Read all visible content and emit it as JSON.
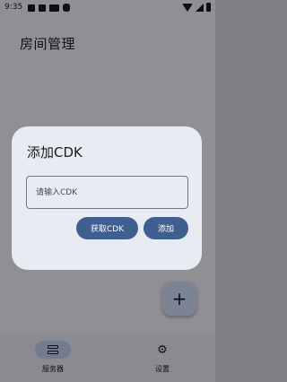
{
  "status_bar": {
    "time": "9:35",
    "left_icons": [
      "notification-icon",
      "media-icon",
      "sim-icon",
      "bug-icon"
    ],
    "right_icons": [
      "wifi-icon",
      "signal-icon",
      "battery-icon"
    ]
  },
  "page": {
    "title": "房间管理"
  },
  "fab": {
    "icon": "plus-icon",
    "label": "+"
  },
  "bottom_nav": {
    "items": [
      {
        "label": "服务器",
        "icon": "server-icon",
        "selected": true
      },
      {
        "label": "设置",
        "icon": "gear-icon",
        "selected": false
      }
    ]
  },
  "dialog": {
    "title": "添加CDK",
    "input": {
      "value": "",
      "placeholder": "请输入CDK"
    },
    "buttons": {
      "get_cdk": "获取CDK",
      "add": "添加"
    }
  },
  "colors": {
    "primary": "#3f5f91",
    "surface": "#e9ebf2",
    "fab": "#d6e3ff",
    "nav_selected": "#c5d6f7"
  }
}
